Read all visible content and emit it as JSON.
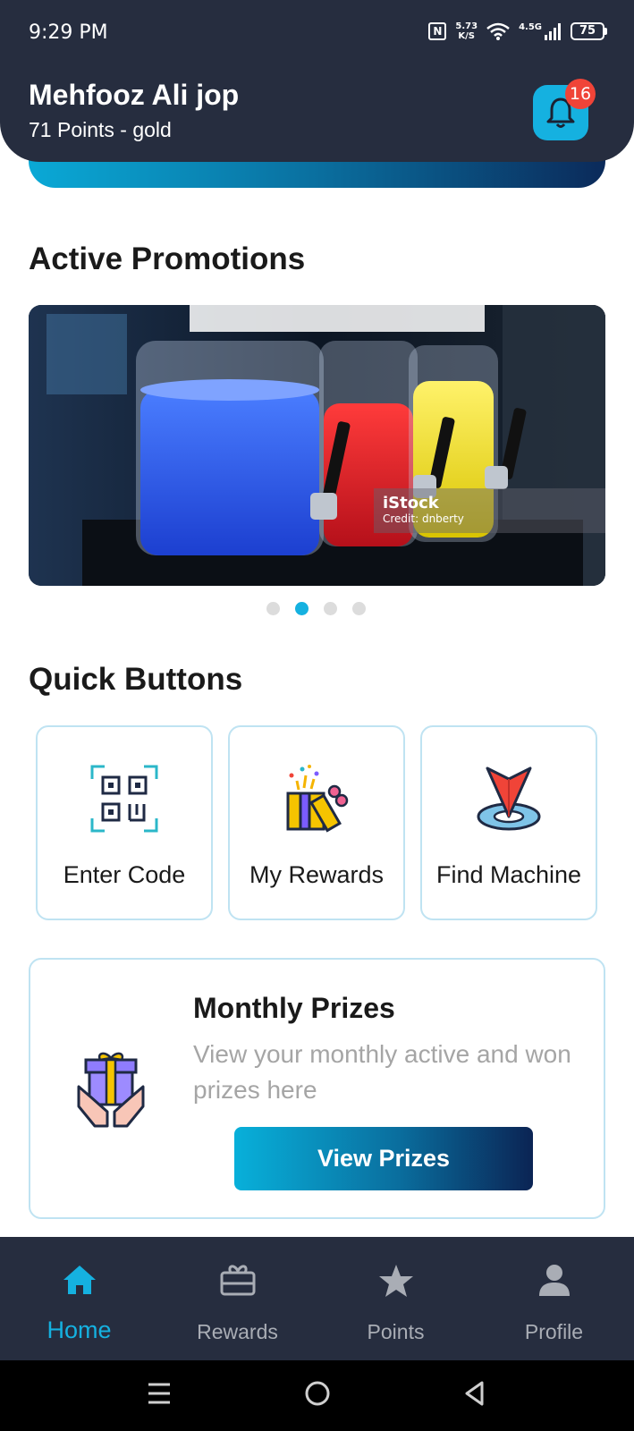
{
  "status_bar": {
    "time": "9:29 PM",
    "net_speed_value": "5.73",
    "net_speed_unit": "K/S",
    "network": "4.5G",
    "battery": "75"
  },
  "header": {
    "user_name": "Mehfooz Ali jop",
    "points_line": "71 Points - gold",
    "notification_count": "16"
  },
  "promotions": {
    "title": "Active Promotions",
    "image_brand": "iStock",
    "image_credit": "Credit: dnberty",
    "slide_count": 4,
    "active_slide": 2
  },
  "quick_buttons": {
    "title": "Quick Buttons",
    "items": [
      {
        "label": "Enter Code",
        "icon": "qr-code-icon"
      },
      {
        "label": "My Rewards",
        "icon": "gift-box-icon"
      },
      {
        "label": "Find Machine",
        "icon": "location-pin-icon"
      }
    ]
  },
  "monthly_prizes": {
    "title": "Monthly Prizes",
    "description": "View your monthly active and won prizes here",
    "button_label": "View Prizes"
  },
  "bottom_nav": {
    "items": [
      {
        "label": "Home",
        "icon": "home-icon",
        "active": true
      },
      {
        "label": "Rewards",
        "icon": "rewards-icon",
        "active": false
      },
      {
        "label": "Points",
        "icon": "star-icon",
        "active": false
      },
      {
        "label": "Profile",
        "icon": "person-icon",
        "active": false
      }
    ]
  },
  "colors": {
    "header_bg": "#262d3f",
    "accent": "#15b1e0",
    "badge": "#f04438",
    "card_border": "#bfe3f2"
  }
}
